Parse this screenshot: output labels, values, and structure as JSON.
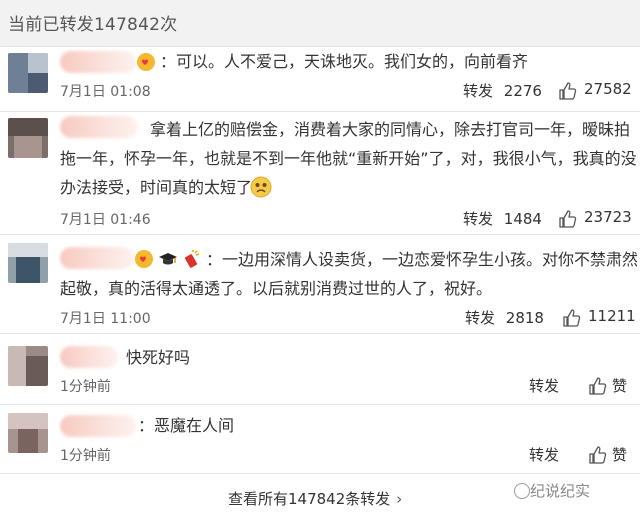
{
  "header": {
    "title": "当前已转发147842次"
  },
  "comments": [
    {
      "content": "：可以。人不爱己，天诛地灭。我们女的，向前看齐",
      "time": "7月1日 01:08",
      "repost_label": "转发",
      "repost_count": "2276",
      "like_count": "27582"
    },
    {
      "content_line1": "拿着上亿的赔偿金，消费着大家的同情心，除去打官司一年，暧昧拍",
      "content_line2": "拖一年，怀孕一年，也就是不到一年他就“重新开始”了，对，我很小气，我真的没",
      "content_line3": "办法接受，时间真的太短了",
      "time": "7月1日 01:46",
      "repost_label": "转发",
      "repost_count": "1484",
      "like_count": "23723"
    },
    {
      "content_line1": "一边用深情人设卖货，一边恋爱怀孕生小孩。对你不禁肃然",
      "content_line2": "起敬，真的活得太通透了。以后就别消费过世的人了，祝好。",
      "time": "7月1日 11:00",
      "repost_label": "转发",
      "repost_count": "2818",
      "like_count": "11211"
    },
    {
      "content": "快死好吗",
      "time": "1分钟前",
      "repost_label": "转发",
      "like_label": "赞"
    },
    {
      "content": "：恶魔在人间",
      "time": "1分钟前",
      "repost_label": "转发",
      "like_label": "赞"
    }
  ],
  "footer": {
    "view_all": "查看所有147842条转发"
  },
  "watermark": {
    "text": "纪说纪实"
  },
  "icons": {
    "thumbs_up": "thumbs-up-icon",
    "chevron": "chevron-right-icon",
    "chevron_glyph": "›"
  }
}
